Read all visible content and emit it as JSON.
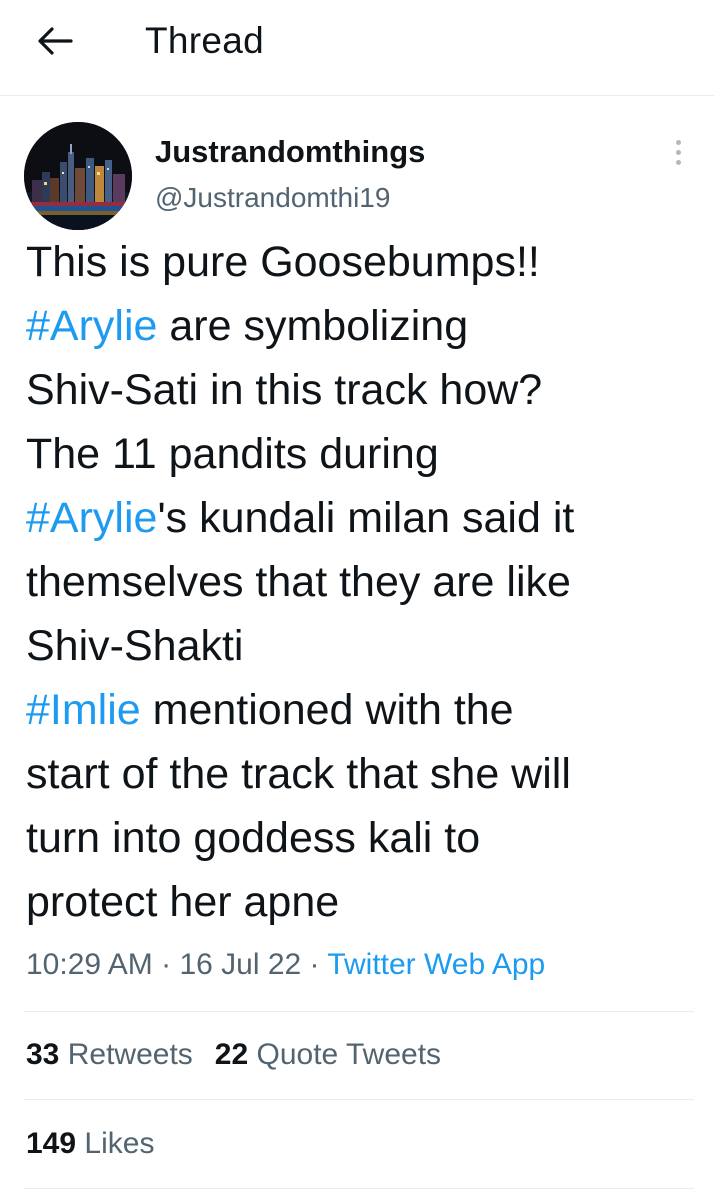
{
  "header": {
    "back_icon": "arrow-left-icon",
    "title": "Thread"
  },
  "tweet": {
    "author": {
      "name": "Justrandomthings",
      "handle": "@Justrandomthi19",
      "avatar": "city-skyline-night"
    },
    "more_icon": "more-vertical-icon",
    "text_lines": [
      [
        {
          "text": "This is pure Goosebumps!!",
          "hashtag": false
        }
      ],
      [
        {
          "text": "#Arylie",
          "hashtag": true
        },
        {
          "text": " are symbolizing",
          "hashtag": false
        }
      ],
      [
        {
          "text": "Shiv-Sati in this track how?",
          "hashtag": false
        }
      ],
      [
        {
          "text": "The 11 pandits during",
          "hashtag": false
        }
      ],
      [
        {
          "text": "#Arylie",
          "hashtag": true
        },
        {
          "text": "'s kundali milan said it",
          "hashtag": false
        }
      ],
      [
        {
          "text": "themselves that they are like",
          "hashtag": false
        }
      ],
      [
        {
          "text": "Shiv-Shakti",
          "hashtag": false
        }
      ],
      [
        {
          "text": "#Imlie",
          "hashtag": true
        },
        {
          "text": " mentioned with the",
          "hashtag": false
        }
      ],
      [
        {
          "text": "start of the track that she will",
          "hashtag": false
        }
      ],
      [
        {
          "text": "turn into goddess kali to",
          "hashtag": false
        }
      ],
      [
        {
          "text": "protect her apne",
          "hashtag": false
        }
      ]
    ],
    "time": "10:29 AM",
    "separator": " · ",
    "date": "16 Jul 22",
    "source": "Twitter Web App"
  },
  "stats": {
    "retweets_count": "33",
    "retweets_label": "Retweets",
    "quotes_count": "22",
    "quotes_label": "Quote Tweets",
    "likes_count": "149",
    "likes_label": "Likes"
  },
  "colors": {
    "accent": "#1d9bf0",
    "text": "#0f1419",
    "secondary": "#536471",
    "divider": "#e6ecf0"
  }
}
